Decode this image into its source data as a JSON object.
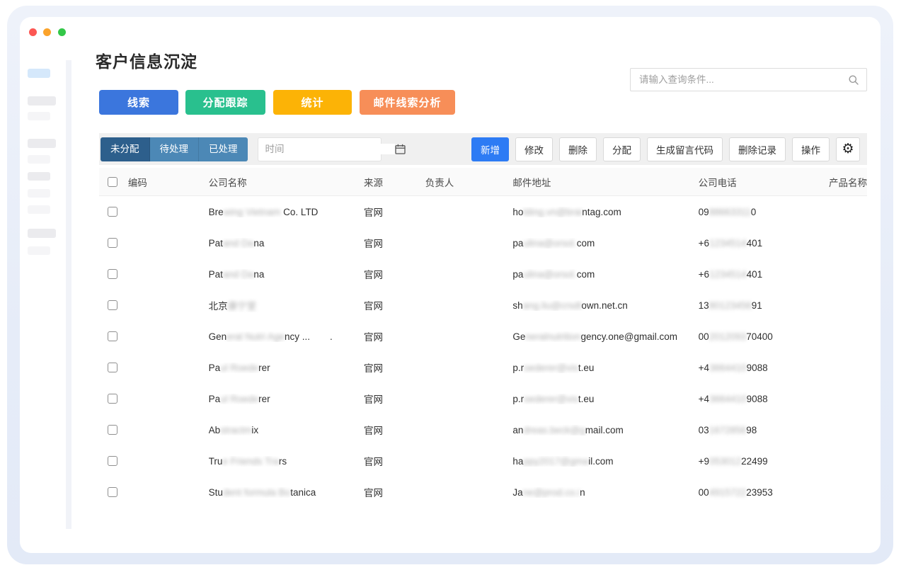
{
  "colors": {
    "accent_blue": "#3b76dd",
    "accent_green": "#29c08e",
    "accent_yellow": "#fcb306",
    "accent_orange": "#f78e58",
    "primary_button_blue": "#2d7bf4",
    "tab_active": "#2d5f8c",
    "tab_inactive": "#4c88b6",
    "traffic_red": "#fc5753",
    "traffic_yellow": "#fba32b",
    "traffic_green": "#33c748",
    "sidebar_active": "#d5e8fb"
  },
  "page": {
    "title": "客户信息沉淀"
  },
  "search": {
    "placeholder": "请输入查询条件...",
    "icon": "magnifier-icon"
  },
  "nav_buttons": [
    {
      "label": "线索",
      "color": "#3b76dd"
    },
    {
      "label": "分配跟踪",
      "color": "#29c08e"
    },
    {
      "label": "统计",
      "color": "#fcb306"
    },
    {
      "label": "邮件线索分析",
      "color": "#f78e58"
    }
  ],
  "toolbar": {
    "tabs": [
      {
        "label": "未分配",
        "active": true
      },
      {
        "label": "待处理",
        "active": false
      },
      {
        "label": "已处理",
        "active": false
      }
    ],
    "date_placeholder": "时间",
    "date_icon": "calendar-icon",
    "actions": [
      {
        "label": "新增",
        "primary": true
      },
      {
        "label": "修改"
      },
      {
        "label": "删除"
      },
      {
        "label": "分配"
      },
      {
        "label": "生成留言代码"
      },
      {
        "label": "删除记录"
      },
      {
        "label": "操作"
      }
    ],
    "settings_icon": "gear-icon"
  },
  "sidebar": {
    "items": [
      {
        "style": "active",
        "wide": false
      },
      {
        "style": "dark",
        "wide": true
      },
      {
        "style": "light",
        "wide": false
      },
      {
        "style": "dark",
        "wide": true
      },
      {
        "style": "light",
        "wide": false
      },
      {
        "style": "dark",
        "wide": false
      },
      {
        "style": "light",
        "wide": false
      },
      {
        "style": "light",
        "wide": false
      },
      {
        "style": "dark",
        "wide": true
      },
      {
        "style": "light",
        "wide": false
      }
    ]
  },
  "table": {
    "columns": [
      "编码",
      "公司名称",
      "来源",
      "负责人",
      "邮件地址",
      "公司电话",
      "产品名称"
    ],
    "rows": [
      {
        "code": "",
        "company": [
          {
            "t": "Bre"
          },
          {
            "t": "wing Vietnam",
            "blur": true
          },
          {
            "t": " Co. LTD"
          }
        ],
        "source": "官网",
        "owner": "",
        "email": [
          {
            "t": "ho"
          },
          {
            "t": "lding.vn@brai",
            "blur": true
          },
          {
            "t": "ntag.com"
          }
        ],
        "phone": [
          {
            "t": "09"
          },
          {
            "t": "88663311",
            "blur": true
          },
          {
            "t": "0"
          }
        ],
        "product": ""
      },
      {
        "code": "",
        "company": [
          {
            "t": "Pat"
          },
          {
            "t": "and Da",
            "blur": true
          },
          {
            "t": "na"
          }
        ],
        "source": "官网",
        "owner": "",
        "email": [
          {
            "t": "pa"
          },
          {
            "t": "ulina@orsol.",
            "blur": true
          },
          {
            "t": "com"
          }
        ],
        "phone": [
          {
            "t": "+6"
          },
          {
            "t": "1234514",
            "blur": true
          },
          {
            "t": "401"
          }
        ],
        "product": ""
      },
      {
        "code": "",
        "company": [
          {
            "t": "Pat"
          },
          {
            "t": "and Da",
            "blur": true
          },
          {
            "t": "na"
          }
        ],
        "source": "官网",
        "owner": "",
        "email": [
          {
            "t": "pa"
          },
          {
            "t": "ulina@orsol.",
            "blur": true
          },
          {
            "t": "com"
          }
        ],
        "phone": [
          {
            "t": "+6"
          },
          {
            "t": "1234514",
            "blur": true
          },
          {
            "t": "401"
          }
        ],
        "product": ""
      },
      {
        "code": "",
        "company": [
          {
            "t": "北京"
          },
          {
            "t": "康宁堂",
            "blur": true
          }
        ],
        "source": "官网",
        "owner": "",
        "email": [
          {
            "t": "sh"
          },
          {
            "t": "ang.liu@crsdt",
            "blur": true
          },
          {
            "t": "own.net.cn"
          }
        ],
        "phone": [
          {
            "t": "13"
          },
          {
            "t": "80123456",
            "blur": true
          },
          {
            "t": "91"
          }
        ],
        "product": ""
      },
      {
        "code": "",
        "company": [
          {
            "t": "Gen"
          },
          {
            "t": "eral Nutri Age",
            "blur": true
          },
          {
            "t": "ncy ..."
          },
          {
            "t": ".",
            "gap": 28
          }
        ],
        "source": "官网",
        "owner": "",
        "email": [
          {
            "t": "Ge"
          },
          {
            "t": "neralnutrition",
            "blur": true
          },
          {
            "t": "gency.one@gmail.com"
          }
        ],
        "phone": [
          {
            "t": "00"
          },
          {
            "t": "2012093",
            "blur": true
          },
          {
            "t": "70400"
          }
        ],
        "product": ""
      },
      {
        "code": "",
        "company": [
          {
            "t": "Pa"
          },
          {
            "t": "ul Roede",
            "blur": true
          },
          {
            "t": "rer"
          }
        ],
        "source": "官网",
        "owner": "",
        "email": [
          {
            "t": "p.r"
          },
          {
            "t": "oederer@vis",
            "blur": true
          },
          {
            "t": "t.eu"
          }
        ],
        "phone": [
          {
            "t": "+4"
          },
          {
            "t": "3664410",
            "blur": true
          },
          {
            "t": "9088"
          }
        ],
        "product": ""
      },
      {
        "code": "",
        "company": [
          {
            "t": "Pa"
          },
          {
            "t": "ul Roede",
            "blur": true
          },
          {
            "t": "rer"
          }
        ],
        "source": "官网",
        "owner": "",
        "email": [
          {
            "t": "p.r"
          },
          {
            "t": "oederer@vis",
            "blur": true
          },
          {
            "t": "t.eu"
          }
        ],
        "phone": [
          {
            "t": "+4"
          },
          {
            "t": "3664410",
            "blur": true
          },
          {
            "t": "9088"
          }
        ],
        "product": ""
      },
      {
        "code": "",
        "company": [
          {
            "t": "Ab"
          },
          {
            "t": "stractm",
            "blur": true
          },
          {
            "t": "ix"
          }
        ],
        "source": "官网",
        "owner": "",
        "email": [
          {
            "t": "an"
          },
          {
            "t": "dreas.beck@g",
            "blur": true
          },
          {
            "t": "mail.com"
          }
        ],
        "phone": [
          {
            "t": "03"
          },
          {
            "t": "1672856",
            "blur": true
          },
          {
            "t": "98"
          }
        ],
        "product": ""
      },
      {
        "code": "",
        "company": [
          {
            "t": "Tru"
          },
          {
            "t": "e Friends Tra",
            "blur": true
          },
          {
            "t": "rs"
          }
        ],
        "source": "官网",
        "owner": "",
        "email": [
          {
            "t": "ha"
          },
          {
            "t": "ppy2017@gma",
            "blur": true
          },
          {
            "t": "il.com"
          }
        ],
        "phone": [
          {
            "t": "+9"
          },
          {
            "t": "053012",
            "blur": true
          },
          {
            "t": "22499"
          }
        ],
        "product": ""
      },
      {
        "code": "",
        "company": [
          {
            "t": "Stu"
          },
          {
            "t": "dent formula Bo",
            "blur": true
          },
          {
            "t": "tanica"
          }
        ],
        "source": "官网",
        "owner": "",
        "email": [
          {
            "t": "Ja"
          },
          {
            "t": "ne@prod.co.i",
            "blur": true
          },
          {
            "t": "n"
          }
        ],
        "phone": [
          {
            "t": "00"
          },
          {
            "t": "4915722",
            "blur": true
          },
          {
            "t": "23953"
          }
        ],
        "product": ""
      }
    ]
  }
}
